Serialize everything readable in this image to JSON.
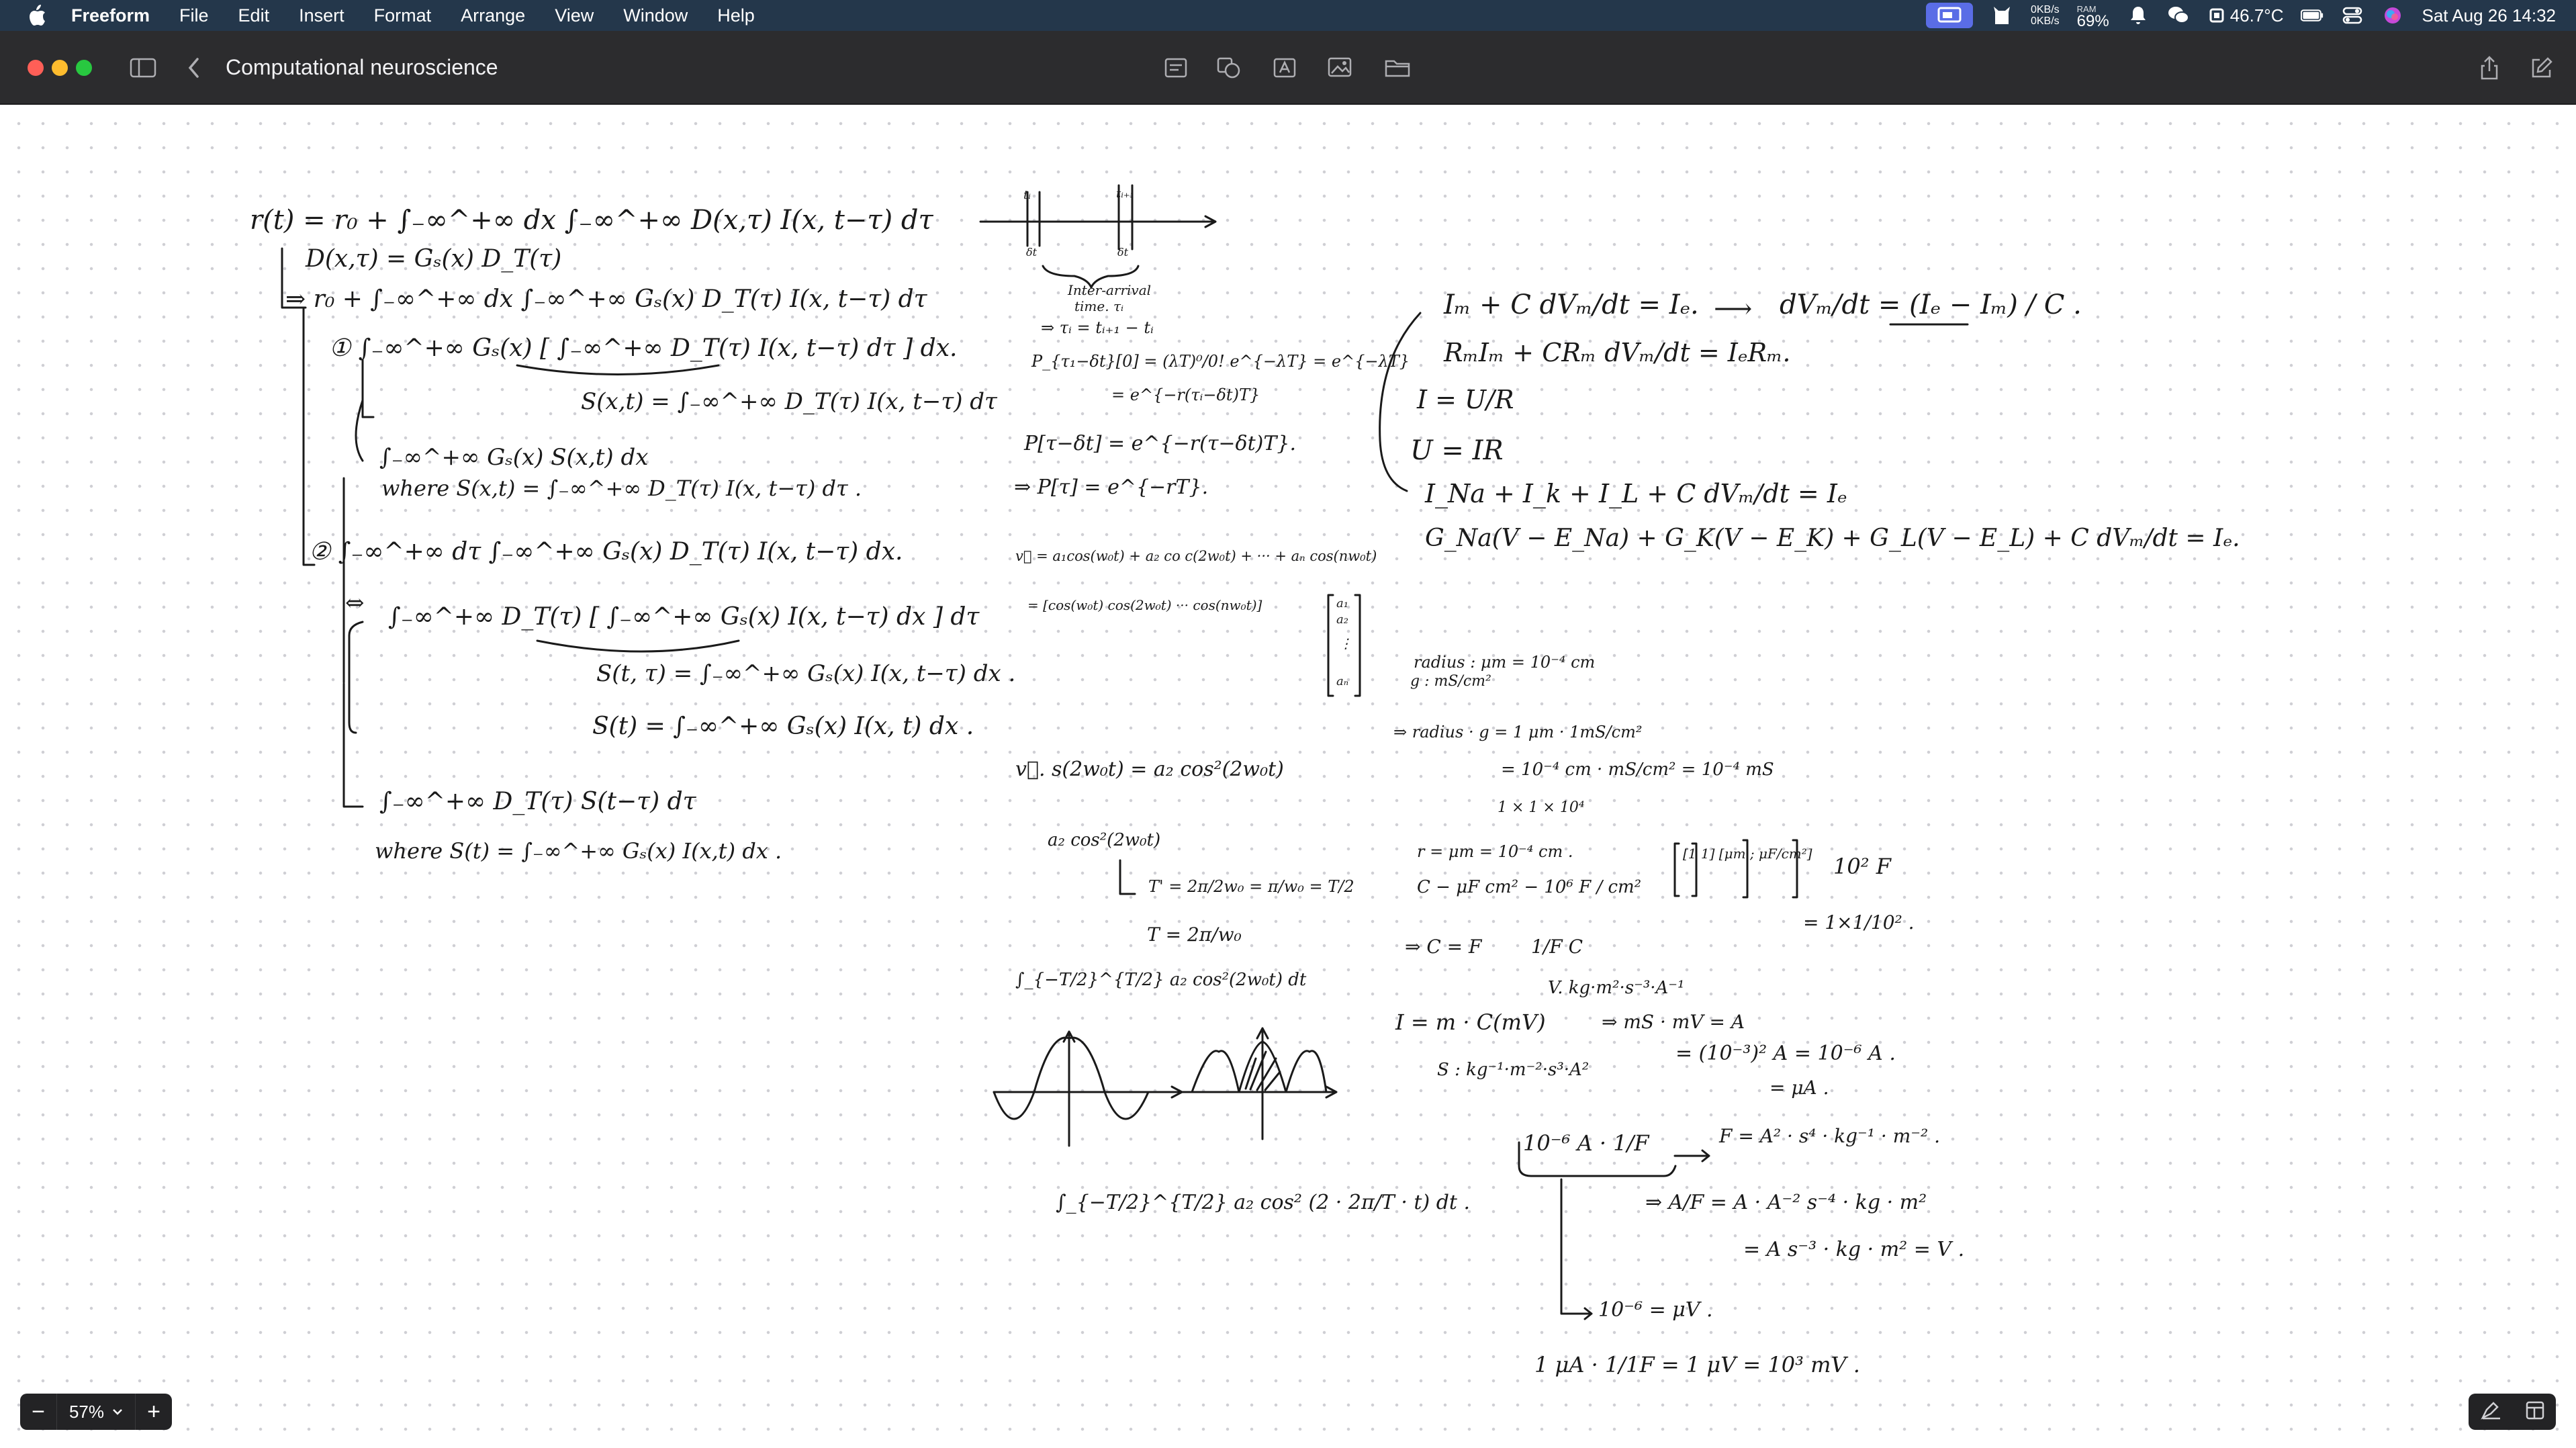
{
  "menubar": {
    "app_name": "Freeform",
    "menus": [
      "File",
      "Edit",
      "Insert",
      "Format",
      "Arrange",
      "View",
      "Window",
      "Help"
    ],
    "net_up": "0KB/s",
    "net_down": "0KB/s",
    "ram_label": "RAM",
    "ram_value": "69%",
    "temperature": "46.7°C",
    "datetime": "Sat Aug 26  14:32"
  },
  "window": {
    "title": "Computational neuroscience"
  },
  "zoom": {
    "value": "57%",
    "minus": "−",
    "plus": "+"
  },
  "notes": {
    "a1": "r(t) = r₀ + ∫₋∞^+∞ dx ∫₋∞^+∞ D(x,τ) I(x, t−τ) dτ",
    "a2": "D(x,τ) = Gₛ(x) D_T(τ)",
    "a3": "⇒ r₀ + ∫₋∞^+∞ dx ∫₋∞^+∞ Gₛ(x) D_T(τ) I(x, t−τ) dτ",
    "a4": "① ∫₋∞^+∞ Gₛ(x) [ ∫₋∞^+∞ D_T(τ) I(x, t−τ) dτ ] dx.",
    "a5": "S(x,t) = ∫₋∞^+∞ D_T(τ) I(x, t−τ) dτ",
    "a6": "∫₋∞^+∞ Gₛ(x) S(x,t) dx",
    "a7": "where  S(x,t) = ∫₋∞^+∞ D_T(τ) I(x, t−τ) dτ .",
    "a8": "② ∫₋∞^+∞ dτ ∫₋∞^+∞ Gₛ(x) D_T(τ) I(x, t−τ) dx.",
    "a9": "⇔",
    "a10": "∫₋∞^+∞ D_T(τ) [ ∫₋∞^+∞ Gₛ(x) I(x, t−τ) dx ] dτ",
    "a11": "S(t, τ) = ∫₋∞^+∞ Gₛ(x) I(x, t−τ) dx .",
    "a12": "S(t) = ∫₋∞^+∞ Gₛ(x) I(x, t) dx .",
    "a13": "∫₋∞^+∞ D_T(τ) S(t−τ) dτ",
    "a14": "where  S(t) = ∫₋∞^+∞ Gₛ(x) I(x,t) dx .",
    "b1": "tᵢ",
    "b2": "tᵢ₊₁",
    "b3": "δt",
    "b4": "δt",
    "b5": "Inter-arrival",
    "b6": "time. τᵢ",
    "b7": "⇒ τᵢ = tᵢ₊₁ − tᵢ",
    "b8": "P_{τ₁−δt}[0] = (λT)⁰/0! e^{−λT} = e^{−λT}",
    "b9": "= e^{−r(τᵢ−δt)T}",
    "b10": "P[τ−δt] = e^{−r(τ−δt)T}.",
    "b11": "⇒ P[τ] = e^{−rT}.",
    "b12": "v⃗ = a₁cos(w₀t) + a₂ co c(2w₀t) + ··· + aₙ cos(nw₀t)",
    "b13": "= [cos(w₀t)  cos(2w₀t) ··· cos(nw₀t)]",
    "b14": "a₁",
    "b15": "a₂",
    "b16": "⋮",
    "b17": "aₙ",
    "b18": "v⃗.   s(2w₀t) = a₂ cos²(2w₀t)",
    "b19": "a₂ cos²(2w₀t)",
    "b20": "T' = 2π/2w₀ = π/w₀ = T/2",
    "b21": "T = 2π/w₀",
    "b22": "∫_{−T/2}^{T/2} a₂ cos²(2w₀t) dt",
    "b23": "∫_{−T/2}^{T/2} a₂ cos² (2 · 2π/T · t) dt .",
    "c1": "Iₘ + C dVₘ/dt = Iₑ.",
    "c2": "⟶",
    "c3": "dVₘ/dt  =  (Iₑ − Iₘ) / C .",
    "c4": "RₘIₘ + CRₘ dVₘ/dt = IₑRₘ.",
    "c5": "I = U/R",
    "c6": "U = IR",
    "c7": "I_Na + I_k + I_L + C dVₘ/dt = Iₑ",
    "c8": "G_Na(V − E_Na) + G_K(V − E_K) + G_L(V − E_L) + C dVₘ/dt = Iₑ.",
    "d1": "radius : μm = 10⁻⁴ cm",
    "d2": "g : mS/cm²",
    "d3": "⇒ radius · g = 1 μm · 1mS/cm²",
    "d4": "= 10⁻⁴ cm · mS/cm² = 10⁻⁴ mS",
    "d5": "1 × 1 × 10⁴",
    "d6": "r = μm = 10⁻⁴ cm .",
    "d7": "C − μF  cm²  −  10⁶ F / cm²",
    "d8": "[1  1] [μm ; μF/cm²]",
    "d9": "10² F",
    "d10": "= 1×1/10² .",
    "d11": "⇒ C = F",
    "d12": "1/F  C",
    "d13": "V. kg·m²·s⁻³·A⁻¹",
    "d14": "I =  m  · C(mV)",
    "d15": "⇒ mS · mV = A",
    "d16": "= (10⁻³)² A = 10⁻⁶ A .",
    "d17": "= μA .",
    "d18": "S : kg⁻¹·m⁻²·s³·A²",
    "d19": "10⁻⁶ A ·  1/F",
    "d20": "F = A² · s⁴ · kg⁻¹ · m⁻² .",
    "d21": "⇒  A/F = A · A⁻² s⁻⁴ · kg · m²",
    "d22": "= A  s⁻³ · kg · m² = V .",
    "d23": "10⁻⁶  = μV .",
    "d24": "1 μA ·  1/1F  =  1 μV  =  10³ mV ."
  }
}
